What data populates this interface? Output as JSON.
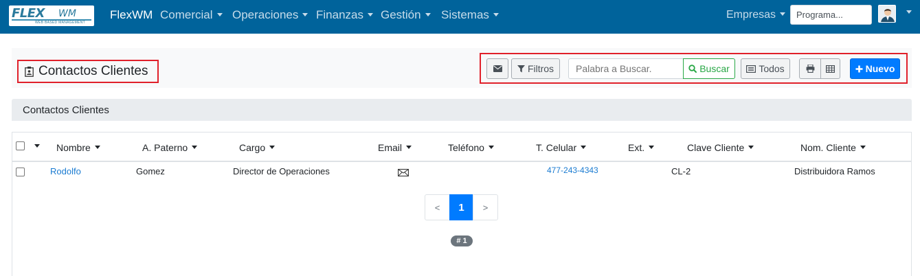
{
  "navbar": {
    "logo_text": "FLEX",
    "logo_suffix": "WM",
    "logo_tagline": "WEB BASED MANAGEMENT",
    "brand": "FlexWM",
    "menus": [
      "Comercial",
      "Operaciones",
      "Finanzas",
      "Gestión",
      "Sistemas"
    ],
    "empresas": "Empresas",
    "program_search": "Programa...",
    "avatar_icon": "user-avatar-icon"
  },
  "header": {
    "icon": "contact-card-icon",
    "title": "Contactos Clientes"
  },
  "toolbar": {
    "email_icon": "envelope-icon",
    "filters_label": "Filtros",
    "search_placeholder": "Palabra a Buscar.",
    "search_button": "Buscar",
    "all_label": "Todos",
    "print_icon": "print-icon",
    "table_icon": "table-icon",
    "new_label": "Nuevo"
  },
  "section": {
    "title": "Contactos Clientes"
  },
  "table": {
    "columns": [
      "Nombre",
      "A. Paterno",
      "Cargo",
      "Email",
      "Teléfono",
      "T. Celular",
      "Ext.",
      "Clave Cliente",
      "Nom. Cliente"
    ],
    "rows": [
      {
        "nombre": "Rodolfo",
        "paterno": "Gomez",
        "cargo": "Director de Operaciones",
        "email_icon": "envelope-outline-icon",
        "telefono": "",
        "celular": "477-243-4343",
        "ext": "",
        "clave": "CL-2",
        "cliente": "Distribuidora Ramos"
      }
    ]
  },
  "pagination": {
    "prev": "<",
    "current": "1",
    "next": ">",
    "total_badge": "# 1"
  },
  "colors": {
    "navbar": "#00639b",
    "primary": "#007bff",
    "success": "#28a745",
    "highlight": "#e0202a"
  }
}
